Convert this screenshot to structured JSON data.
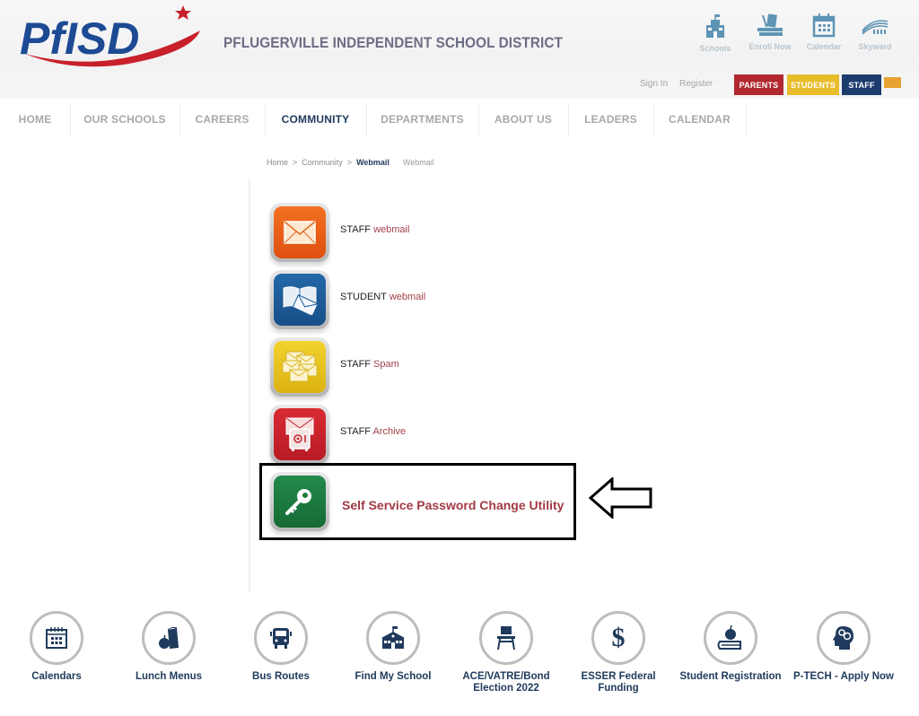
{
  "header": {
    "logo_text": "PfISD",
    "district_name": "PFLUGERVILLE INDEPENDENT SCHOOL DISTRICT",
    "quick_icons": [
      {
        "label": "Schools",
        "icon": "school-building-icon"
      },
      {
        "label": "Enroll Now",
        "icon": "books-icon"
      },
      {
        "label": "Calendar",
        "icon": "calendar-icon"
      },
      {
        "label": "Skyward",
        "icon": "skyward-icon"
      }
    ],
    "sign_in": "Sign In",
    "register": "Register",
    "audiences": [
      {
        "label": "PARENTS",
        "color": "#b1282f"
      },
      {
        "label": "STUDENTS",
        "color": "#e9bc2c"
      },
      {
        "label": "STAFF",
        "color": "#1d3c6e"
      },
      {
        "label": "",
        "color": "#e8a232"
      }
    ]
  },
  "nav": {
    "items": [
      {
        "label": "HOME",
        "active": false
      },
      {
        "label": "OUR SCHOOLS",
        "active": false
      },
      {
        "label": "CAREERS",
        "active": false
      },
      {
        "label": "COMMUNITY",
        "active": true
      },
      {
        "label": "DEPARTMENTS",
        "active": false
      },
      {
        "label": "ABOUT US",
        "active": false
      },
      {
        "label": "LEADERS",
        "active": false
      },
      {
        "label": "CALENDAR",
        "active": false
      }
    ]
  },
  "breadcrumb": {
    "items": [
      "Home",
      "Community",
      "Webmail"
    ],
    "separator": ">",
    "page_title": "Webmail"
  },
  "webmail": {
    "items": [
      {
        "prefix": "STAFF",
        "link": "webmail",
        "icon": "envelope-icon",
        "color": "#ea5b12"
      },
      {
        "prefix": "STUDENT",
        "link": "webmail",
        "icon": "book-envelope-icon",
        "color": "#1c5a9a"
      },
      {
        "prefix": "STAFF",
        "link": "Spam",
        "icon": "stacked-envelopes-icon",
        "color": "#e6c21a"
      },
      {
        "prefix": "STAFF",
        "link": "Archive",
        "icon": "envelope-safe-icon",
        "color": "#c8202b"
      }
    ],
    "password_utility": {
      "label": "Self Service Password Change Utility",
      "icon": "key-icon",
      "color": "#1d7a3c"
    }
  },
  "quick_links": [
    {
      "label": "Calendars",
      "icon": "calendar-icon"
    },
    {
      "label": "Lunch Menus",
      "icon": "lunch-icon"
    },
    {
      "label": "Bus Routes",
      "icon": "bus-icon"
    },
    {
      "label": "Find My School",
      "icon": "school-icon"
    },
    {
      "label": "ACE/VATRE/Bond Election 2022",
      "icon": "desk-icon"
    },
    {
      "label": "ESSER Federal Funding",
      "icon": "dollar-icon"
    },
    {
      "label": "Student Registration",
      "icon": "apple-book-icon"
    },
    {
      "label": "P-TECH - Apply Now",
      "icon": "head-gear-icon"
    }
  ]
}
